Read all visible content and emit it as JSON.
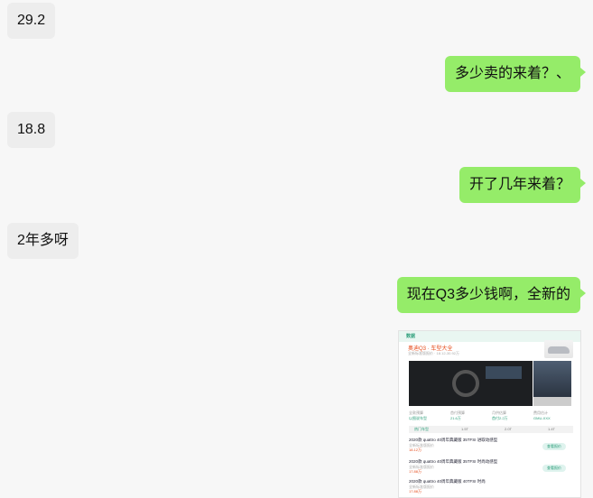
{
  "messages": [
    {
      "side": "in",
      "text": "29.2"
    },
    {
      "side": "out",
      "text": "多少卖的来着？、"
    },
    {
      "side": "in",
      "text": "18.8"
    },
    {
      "side": "out",
      "text": "开了几年来着？"
    },
    {
      "side": "in",
      "text": "2年多呀"
    },
    {
      "side": "out",
      "text": "现在Q3多少钱啊，全新的"
    }
  ],
  "card": {
    "tag": "数据",
    "title": "奥迪Q3 · 车型大全",
    "subtitle": "全新标准版报价 · 18.12-30.92万",
    "specs": [
      {
        "label": "全款预算",
        "value": "以图说车型"
      },
      {
        "label": "首付预算",
        "value": "21.6万"
      },
      {
        "label": "月供估算",
        "value": "首付2.2万"
      },
      {
        "label": "费用估计",
        "value": "GMU-XXX"
      }
    ],
    "tabs": [
      "热门车型",
      "1.5T",
      "2.0T",
      "1.4T"
    ],
    "rows": [
      {
        "name": "2020款 quattro 40周年典藏版 35TFSI 进取动感型",
        "line": "全新标准版报价",
        "price": "18.12万",
        "button": "查看报价"
      },
      {
        "name": "2020款 quattro 40周年典藏版 35TFSI 时尚动感型",
        "line": "全新标准版报价",
        "price": "17.88万",
        "button": "查看报价"
      },
      {
        "name": "2020款 quattro 40周年典藏版 40TFSI 时尚",
        "line": "全新标准版报价",
        "price": "17.88万",
        "button": ""
      }
    ]
  }
}
